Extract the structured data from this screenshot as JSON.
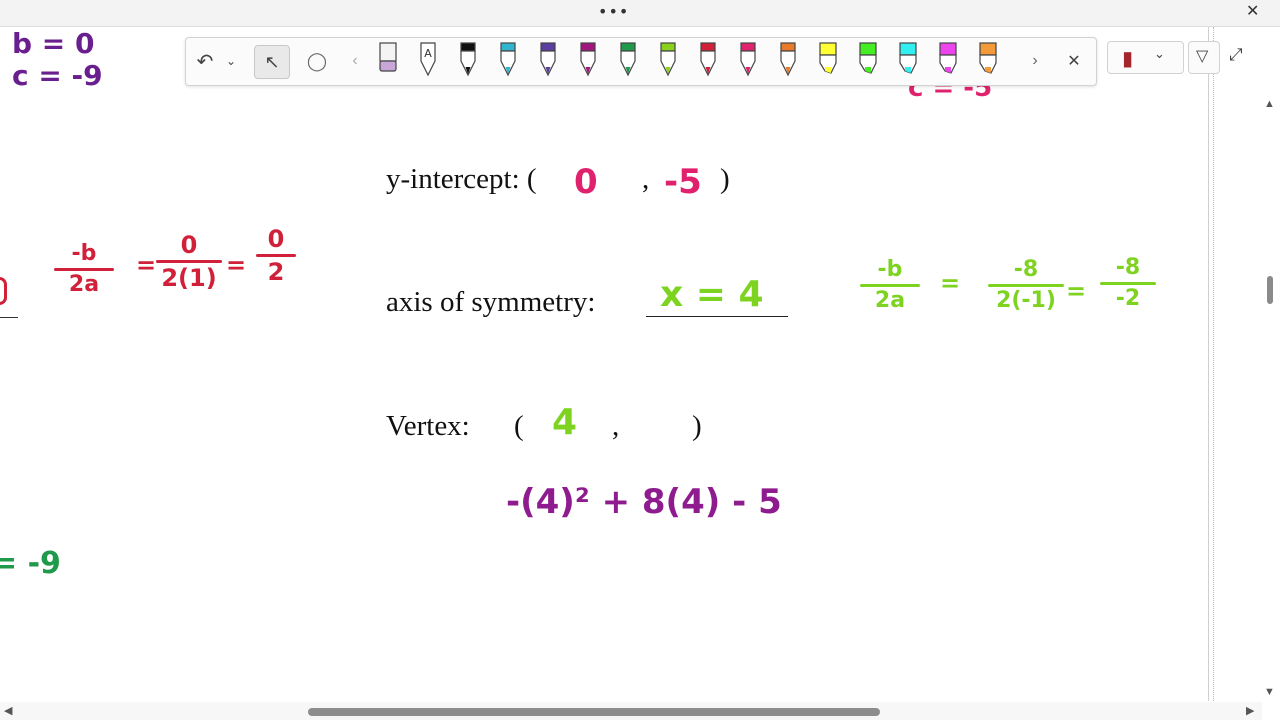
{
  "window": {
    "menu_glyph": "•••",
    "close_glyph": "✕"
  },
  "toolbar": {
    "undo_glyph": "↶",
    "dropdown_glyph": "⌄",
    "select_glyph": "↖",
    "lasso_glyph": "◯",
    "prev_glyph": "‹",
    "next_glyph": "›",
    "close_glyph": "✕",
    "pens": [
      {
        "name": "eraser",
        "color": "#c8a6d8",
        "kind": "eraser"
      },
      {
        "name": "ink-to-text",
        "color": "#ffffff",
        "kind": "text"
      },
      {
        "name": "black-pen",
        "color": "#111111",
        "kind": "pen"
      },
      {
        "name": "cyan-pen",
        "color": "#2fb6cf",
        "kind": "pen"
      },
      {
        "name": "purple-pen",
        "color": "#5b3ea0",
        "kind": "pen"
      },
      {
        "name": "magenta-pen",
        "color": "#a2177f",
        "kind": "pen"
      },
      {
        "name": "green-pen",
        "color": "#1f9a4a",
        "kind": "pen"
      },
      {
        "name": "lime-pen",
        "color": "#8ad21a",
        "kind": "pen"
      },
      {
        "name": "red-pen",
        "color": "#d1203a",
        "kind": "pen"
      },
      {
        "name": "pink-pen",
        "color": "#e0226e",
        "kind": "pen"
      },
      {
        "name": "orange-pen",
        "color": "#e87a2a",
        "kind": "pen"
      },
      {
        "name": "yellow-highlighter",
        "color": "#ffff33",
        "kind": "hl"
      },
      {
        "name": "green-highlighter",
        "color": "#44ee22",
        "kind": "hl"
      },
      {
        "name": "cyan-highlighter",
        "color": "#33eeee",
        "kind": "hl"
      },
      {
        "name": "magenta-highlighter",
        "color": "#ee44ee",
        "kind": "hl"
      },
      {
        "name": "orange-highlighter",
        "color": "#f39a3a",
        "kind": "hl"
      }
    ]
  },
  "right_tools": {
    "notebook_glyph": "▮",
    "dropdown_glyph": "⌄",
    "ruler_glyph": "▽",
    "expand_glyph": "⤢"
  },
  "worksheet": {
    "y_intercept_label": "y-intercept: (",
    "y_intercept_close": ")",
    "y_intercept_x": "0",
    "y_intercept_comma": ",",
    "y_intercept_y": "-5",
    "axis_label": "axis of symmetry:",
    "axis_answer": "x = 4",
    "vertex_label": "Vertex:",
    "vertex_open": "(",
    "vertex_comma": ",",
    "vertex_close": ")",
    "vertex_x": "4",
    "vertex_work": "-(4)² + 8(4) - 5"
  },
  "margin_notes": {
    "b_value": "b = 0",
    "c_value": "c = -9",
    "top_right_partial": "c = -5",
    "left_green": "= -9",
    "red_frac1_num": "-b",
    "red_frac1_den": "2a",
    "red_frac2_num": "0",
    "red_frac2_den": "2(1)",
    "red_frac3_num": "0",
    "red_frac3_den": "2",
    "equals": "=",
    "green_frac1_num": "-b",
    "green_frac1_den": "2a",
    "green_frac2_num": "-8",
    "green_frac2_den": "2(-1)",
    "green_frac3_num": "-8",
    "green_frac3_den": "-2"
  },
  "colors": {
    "purple_ink": "#6a1f8f",
    "pink_ink": "#e0226e",
    "red_ink": "#d1203a",
    "lime_ink": "#7ed321",
    "green_ink": "#1f9a4a",
    "magenta_ink": "#8e1c8f"
  },
  "scrollbars": {
    "up": "▲",
    "down": "▼",
    "left": "◀",
    "right": "▶"
  }
}
